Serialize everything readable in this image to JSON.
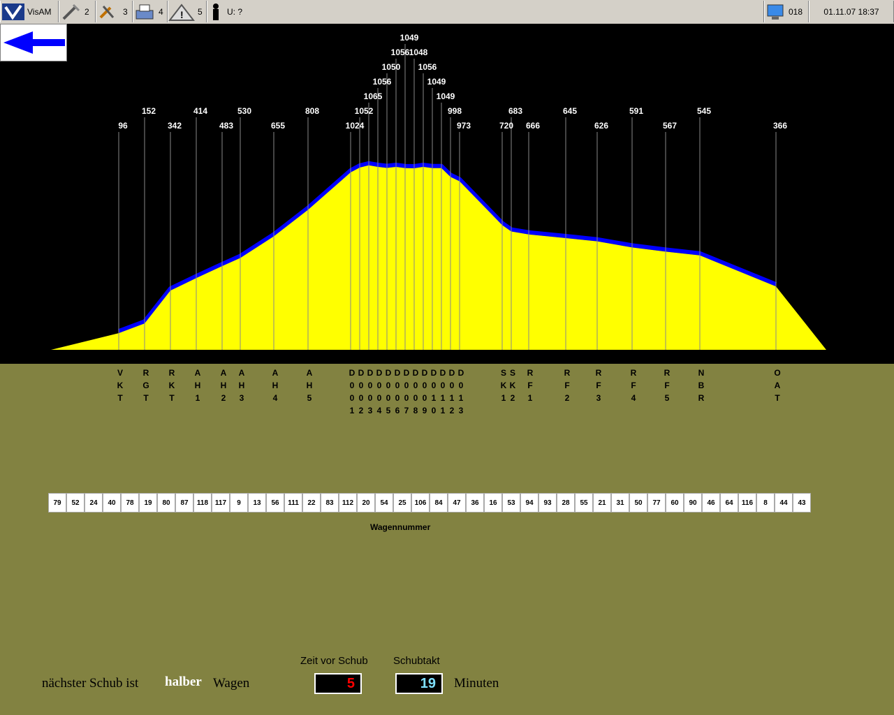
{
  "topbar": {
    "app_name": "VisAM",
    "tools_count": "2",
    "service_count": "3",
    "print_count": "4",
    "alarm_count": "5",
    "user": "U: ?",
    "terminal_id": "018",
    "datetime": "01.11.07 18:37"
  },
  "chart_data": {
    "type": "area",
    "title": "",
    "stations": [
      {
        "code": "VKT",
        "value": 96
      },
      {
        "code": "RGT",
        "value": 152
      },
      {
        "code": "RKT",
        "value": 342
      },
      {
        "code": "AH1",
        "value": 414
      },
      {
        "code": "AH2",
        "value": 483
      },
      {
        "code": "AH3",
        "value": 530
      },
      {
        "code": "AH4",
        "value": 655
      },
      {
        "code": "AH5",
        "value": 808
      },
      {
        "code": "D001",
        "value": 1024
      },
      {
        "code": "D002",
        "value": 1052
      },
      {
        "code": "D003",
        "value": 1065
      },
      {
        "code": "D004",
        "value": 1056
      },
      {
        "code": "D005",
        "value": 1050
      },
      {
        "code": "D006",
        "value": 1056
      },
      {
        "code": "D007",
        "value": 1049
      },
      {
        "code": "D008",
        "value": 1048
      },
      {
        "code": "D009",
        "value": 1056
      },
      {
        "code": "D010",
        "value": 1049
      },
      {
        "code": "D011",
        "value": 1049
      },
      {
        "code": "D012",
        "value": 998
      },
      {
        "code": "D013",
        "value": 973
      },
      {
        "code": "SK1",
        "value": 720
      },
      {
        "code": "SK2",
        "value": 683
      },
      {
        "code": "RF1",
        "value": 666
      },
      {
        "code": "RF2",
        "value": 645
      },
      {
        "code": "RF3",
        "value": 626
      },
      {
        "code": "RF4",
        "value": 591
      },
      {
        "code": "RF5",
        "value": 567
      },
      {
        "code": "NBR",
        "value": 545
      },
      {
        "code": "OAT",
        "value": 366
      }
    ],
    "fill_color": "#ffff00",
    "edge_color": "#0000ff",
    "background": "#000000"
  },
  "cars": [
    "79",
    "52",
    "24",
    "40",
    "78",
    "19",
    "80",
    "87",
    "118",
    "117",
    "9",
    "13",
    "56",
    "111",
    "22",
    "83",
    "112",
    "20",
    "54",
    "25",
    "106",
    "84",
    "47",
    "36",
    "16",
    "53",
    "94",
    "93",
    "28",
    "55",
    "21",
    "31",
    "50",
    "77",
    "60",
    "90",
    "46",
    "64",
    "116",
    "8",
    "44",
    "43"
  ],
  "wagen_label": "Wagennummer",
  "bottom": {
    "next_push_prefix": "nächster Schub ist",
    "push_size": "halber",
    "wagen": "Wagen",
    "zeit_title": "Zeit vor Schub",
    "zeit_value": "5",
    "takt_title": "Schubtakt",
    "takt_value": "19",
    "unit": "Minuten"
  }
}
